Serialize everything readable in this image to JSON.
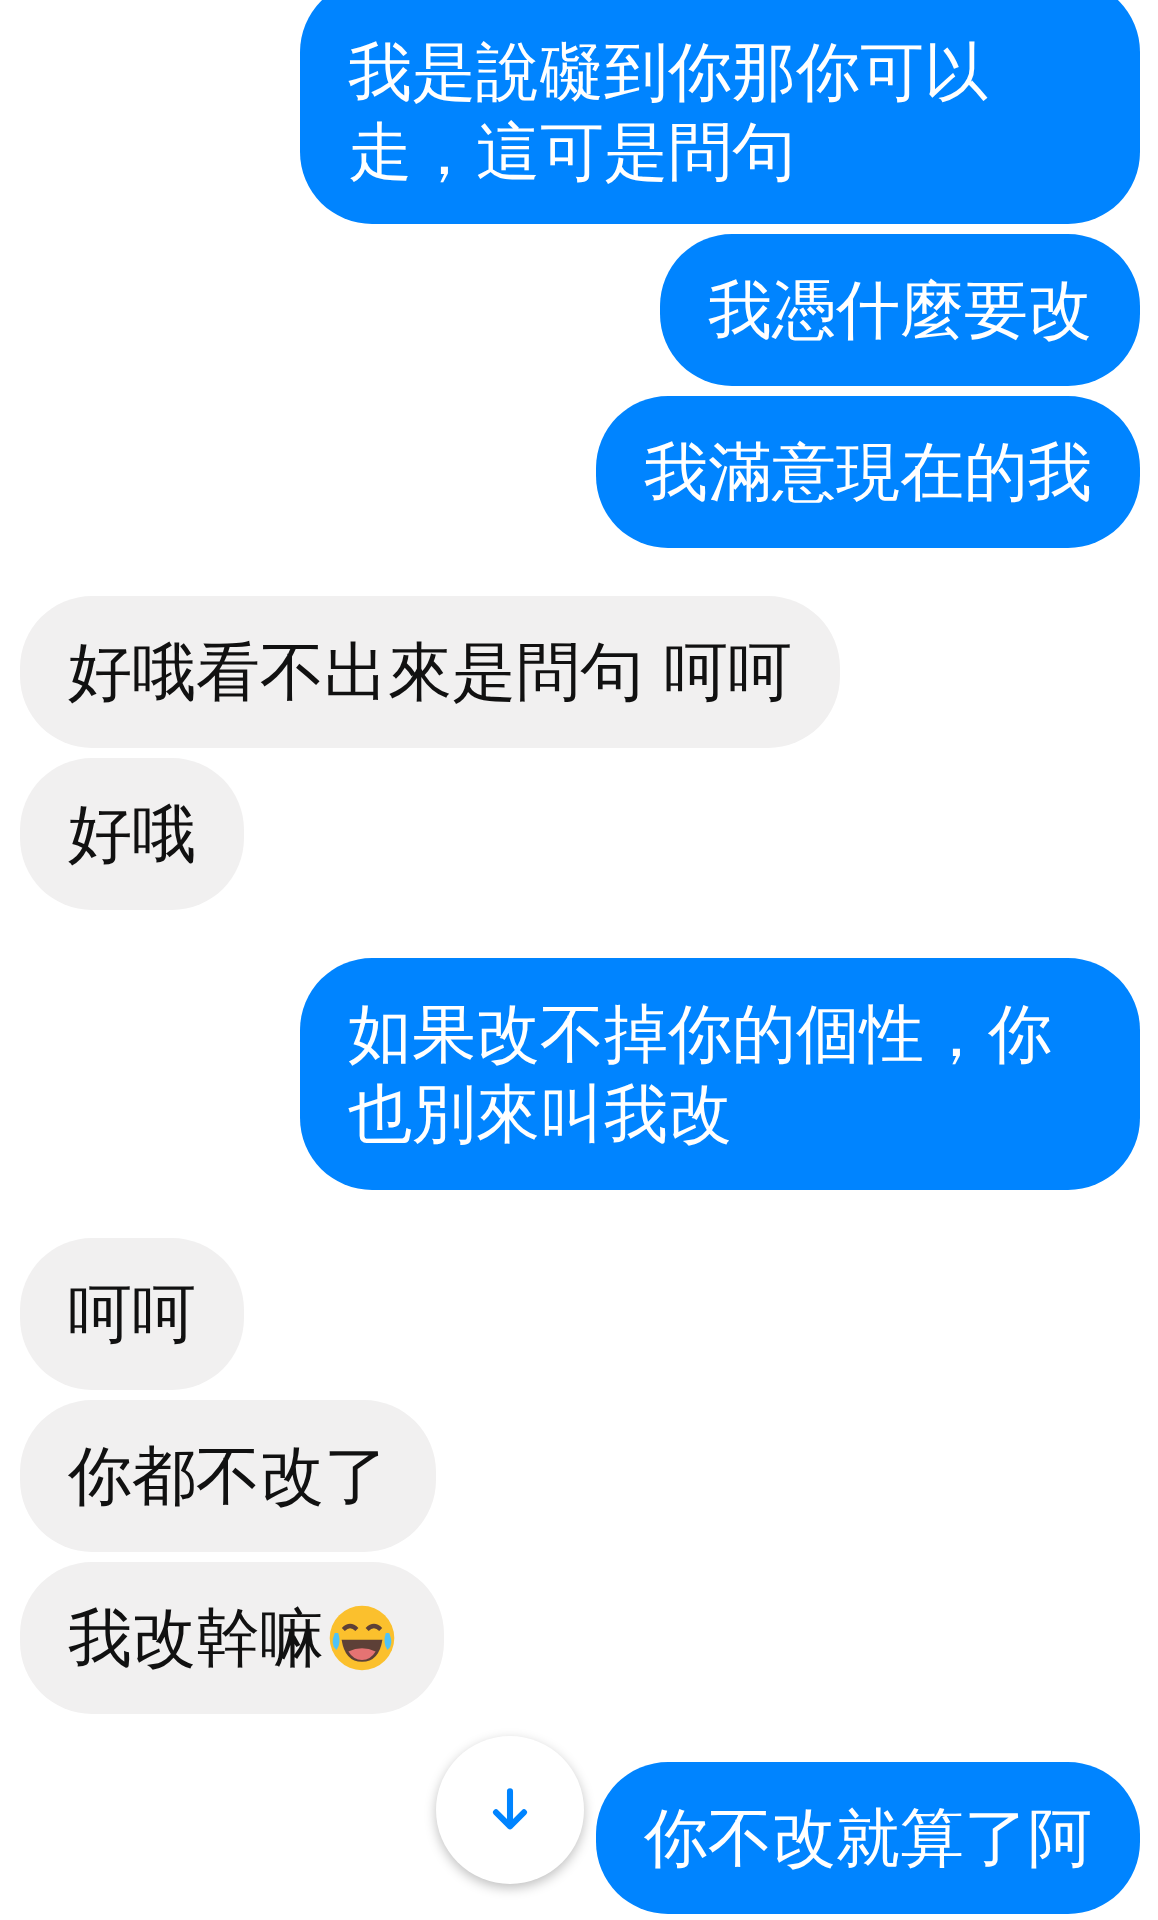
{
  "messages": [
    {
      "outgoing": true,
      "text": "我是說礙到你那你可以走，這可是問句"
    },
    {
      "outgoing": true,
      "text": "我憑什麼要改"
    },
    {
      "outgoing": true,
      "text": "我滿意現在的我"
    },
    {
      "outgoing": false,
      "text": "好哦看不出來是問句 呵呵"
    },
    {
      "outgoing": false,
      "text": "好哦"
    },
    {
      "outgoing": true,
      "text": "如果改不掉你的個性，你也別來叫我改"
    },
    {
      "outgoing": false,
      "text": "呵呵"
    },
    {
      "outgoing": false,
      "text": "你都不改了"
    },
    {
      "outgoing": false,
      "text": "我改幹嘛",
      "laughing_emoji": true
    },
    {
      "outgoing": true,
      "text": "你不改就算了阿"
    }
  ]
}
